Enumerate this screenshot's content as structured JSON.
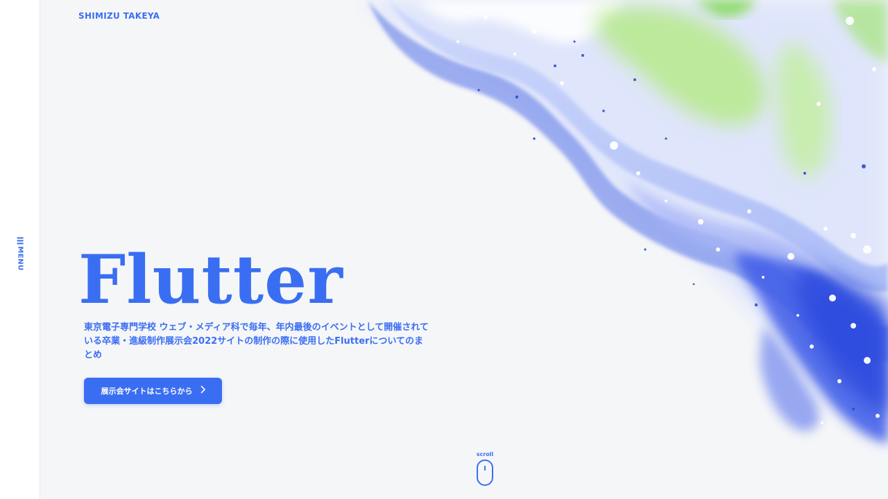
{
  "header": {
    "site_name": "SHIMIZU TAKEYA"
  },
  "sidebar": {
    "menu_label": "MENU",
    "menu_icon": "hamburger-icon"
  },
  "hero": {
    "title": "Flutter",
    "description": "東京電子専門学校 ウェブ・メディア科で毎年、年内最後のイベントとして開催されている卒業・進級制作展示会2022サイトの制作の際に使用したFlutterについてのまとめ",
    "cta_label": "展示会サイトはこちらから",
    "cta_icon": "chevron-right-icon"
  },
  "scroll": {
    "label": "scroll",
    "icon": "mouse-icon"
  },
  "colors": {
    "accent": "#3a6ef2",
    "background": "#f5f6f8",
    "green": "#a8e07a"
  }
}
